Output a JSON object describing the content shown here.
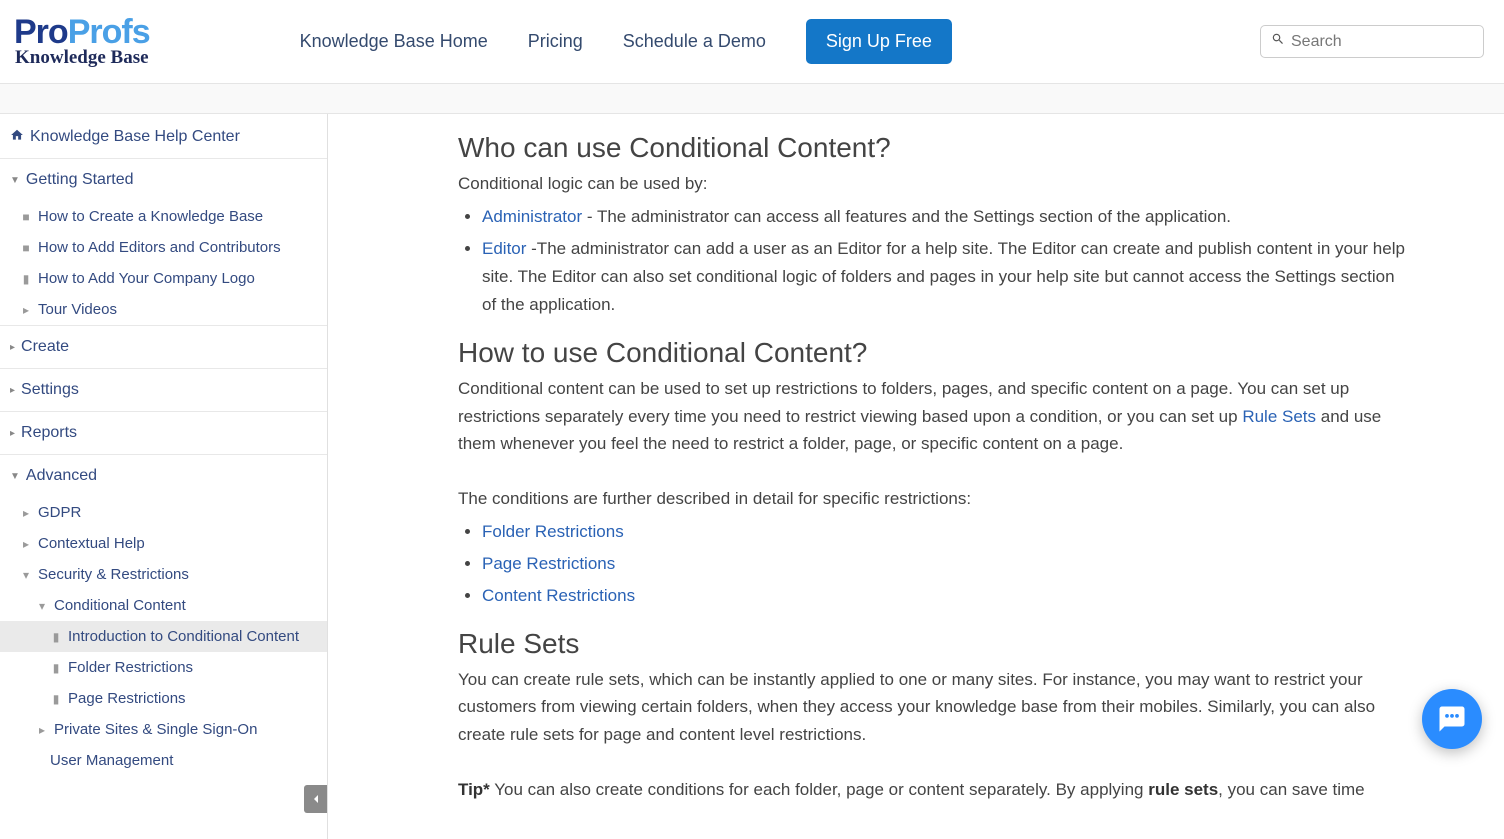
{
  "logo": {
    "part1": "Pro",
    "part2": "Profs",
    "subtitle": "Knowledge Base"
  },
  "nav": {
    "home": "Knowledge Base Home",
    "pricing": "Pricing",
    "demo": "Schedule a Demo",
    "signup": "Sign Up Free"
  },
  "search": {
    "placeholder": "Search"
  },
  "sidebar": {
    "home": "Knowledge Base Help Center",
    "getting_started": {
      "title": "Getting Started",
      "items": [
        "How to Create a Knowledge Base",
        "How to Add Editors and Contributors",
        "How to Add Your Company Logo",
        "Tour Videos"
      ]
    },
    "create": "Create",
    "settings": "Settings",
    "reports": "Reports",
    "advanced": {
      "title": "Advanced",
      "gdpr": "GDPR",
      "contextual": "Contextual Help",
      "security": "Security & Restrictions",
      "conditional": "Conditional Content",
      "intro_cc": "Introduction to Conditional Content",
      "folder_r": "Folder Restrictions",
      "page_r": "Page Restrictions",
      "private": "Private Sites & Single Sign-On",
      "user_mgmt": "User Management"
    }
  },
  "content": {
    "h_who": "Who can use Conditional Content?",
    "p_who": "Conditional logic can be used by:",
    "li_admin_link": "Administrator",
    "li_admin_rest": " - The administrator can access all features and the Settings section of the application.",
    "li_editor_link": "Editor",
    "li_editor_rest": " -The administrator can add a user as an Editor for a help site. The Editor can create and publish content in your help site. The Editor can also set conditional logic of folders and pages in your help site but cannot access the Settings section of the application.",
    "h_how": "How to use Conditional Content?",
    "p_how_a": "Conditional content can be used to set up restrictions to folders, pages, and specific content on a page. You can set up restrictions separately every time you need to restrict viewing based upon a condition, or you can set up ",
    "rule_sets_link": "Rule Sets",
    "p_how_b": " and use them whenever you feel the need to restrict a folder, page, or specific content on a page.",
    "p_cond": "The conditions are further described in detail for specific restrictions:",
    "li_folder": "Folder Restrictions",
    "li_page": "Page Restrictions",
    "li_content": "Content Restrictions",
    "h_rule": "Rule Sets",
    "p_rule": "You can create rule sets, which can be instantly applied to one or many sites. For instance, you may want to restrict your customers from viewing certain folders, when they access your knowledge base from their mobiles.  Similarly, you can also create rule sets for page and content level restrictions.",
    "tip_bold": "Tip*",
    "tip_a": " You can also create conditions for each folder, page or content separately. By applying ",
    "tip_rule_bold": "rule sets",
    "tip_b": ", you can save time"
  }
}
